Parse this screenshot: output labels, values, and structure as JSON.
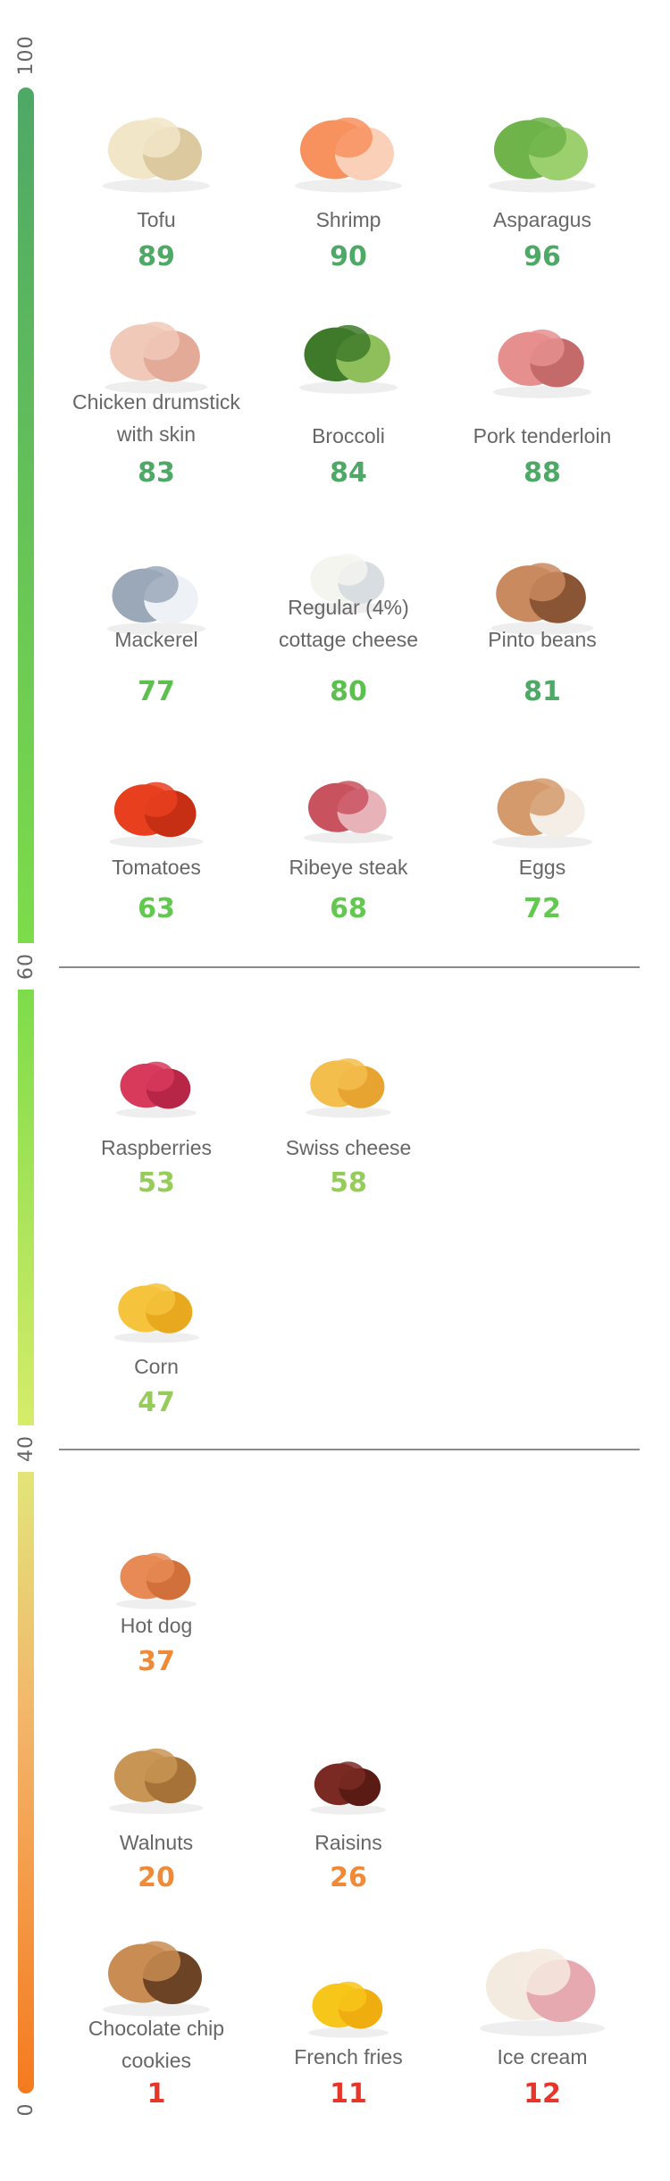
{
  "chart_data": {
    "type": "table",
    "title": "",
    "scale": {
      "min": 0,
      "max": 100,
      "ticks": [
        100,
        60,
        40,
        0
      ]
    },
    "bands": [
      {
        "from": 60,
        "to": 100,
        "colors": [
          "#4ea866",
          "#7ddc4a"
        ]
      },
      {
        "from": 40,
        "to": 60,
        "colors": [
          "#7ddc4a",
          "#d6ec6a"
        ]
      },
      {
        "from": 0,
        "to": 40,
        "colors": [
          "#e2e57a",
          "#f57a1e"
        ]
      }
    ],
    "items": [
      {
        "name": "Tofu",
        "value": 89,
        "band": 0
      },
      {
        "name": "Shrimp",
        "value": 90,
        "band": 0
      },
      {
        "name": "Asparagus",
        "value": 96,
        "band": 0
      },
      {
        "name": "Chicken drumstick with skin",
        "value": 83,
        "band": 0
      },
      {
        "name": "Broccoli",
        "value": 84,
        "band": 0
      },
      {
        "name": "Pork tenderloin",
        "value": 88,
        "band": 0
      },
      {
        "name": "Mackerel",
        "value": 77,
        "band": 0
      },
      {
        "name": "Regular (4%) cottage cheese",
        "value": 80,
        "band": 0
      },
      {
        "name": "Pinto beans",
        "value": 81,
        "band": 0
      },
      {
        "name": "Tomatoes",
        "value": 63,
        "band": 0
      },
      {
        "name": "Ribeye steak",
        "value": 68,
        "band": 0
      },
      {
        "name": "Eggs",
        "value": 72,
        "band": 0
      },
      {
        "name": "Raspberries",
        "value": 53,
        "band": 1
      },
      {
        "name": "Swiss cheese",
        "value": 58,
        "band": 1
      },
      {
        "name": "Corn",
        "value": 47,
        "band": 1
      },
      {
        "name": "Hot dog",
        "value": 37,
        "band": 2
      },
      {
        "name": "Walnuts",
        "value": 20,
        "band": 2
      },
      {
        "name": "Raisins",
        "value": 26,
        "band": 2
      },
      {
        "name": "Chocolate chip cookies",
        "value": 1,
        "band": 2
      },
      {
        "name": "French fries",
        "value": 11,
        "band": 2
      },
      {
        "name": "Ice cream",
        "value": 12,
        "band": 2
      }
    ]
  },
  "axis_labels": [
    "100",
    "60",
    "40",
    "0"
  ],
  "items": [
    {
      "line1": "Tofu",
      "line2": "",
      "value": "89",
      "color": "#4ea866",
      "icon": "tofu-image"
    },
    {
      "line1": "Shrimp",
      "line2": "",
      "value": "90",
      "color": "#4ea866",
      "icon": "shrimp-image"
    },
    {
      "line1": "Asparagus",
      "line2": "",
      "value": "96",
      "color": "#4ea866",
      "icon": "asparagus-image"
    },
    {
      "line1": "Chicken drumstick",
      "line2": "with skin",
      "value": "83",
      "color": "#4ea866",
      "icon": "chicken-drumstick-image"
    },
    {
      "line1": "Broccoli",
      "line2": "",
      "value": "84",
      "color": "#4ea866",
      "icon": "broccoli-image"
    },
    {
      "line1": "Pork tenderloin",
      "line2": "",
      "value": "88",
      "color": "#4ea866",
      "icon": "pork-tenderloin-image"
    },
    {
      "line1": "Mackerel",
      "line2": "",
      "value": "77",
      "color": "#5cc04f",
      "icon": "mackerel-image"
    },
    {
      "line1": "Regular (4%)",
      "line2": "cottage cheese",
      "value": "80",
      "color": "#5cc04f",
      "icon": "cottage-cheese-image"
    },
    {
      "line1": "Pinto beans",
      "line2": "",
      "value": "81",
      "color": "#4ea866",
      "icon": "pinto-beans-image"
    },
    {
      "line1": "Tomatoes",
      "line2": "",
      "value": "63",
      "color": "#62c94f",
      "icon": "tomatoes-image"
    },
    {
      "line1": "Ribeye steak",
      "line2": "",
      "value": "68",
      "color": "#62c94f",
      "icon": "ribeye-steak-image"
    },
    {
      "line1": "Eggs",
      "line2": "",
      "value": "72",
      "color": "#62c94f",
      "icon": "eggs-image"
    },
    {
      "line1": "Raspberries",
      "line2": "",
      "value": "53",
      "color": "#96cc5a",
      "icon": "raspberries-image"
    },
    {
      "line1": "Swiss cheese",
      "line2": "",
      "value": "58",
      "color": "#96cc5a",
      "icon": "swiss-cheese-image"
    },
    {
      "line1": "Corn",
      "line2": "",
      "value": "47",
      "color": "#96cc5a",
      "icon": "corn-image"
    },
    {
      "line1": "Hot dog",
      "line2": "",
      "value": "37",
      "color": "#f08a36",
      "icon": "hot-dog-image"
    },
    {
      "line1": "Walnuts",
      "line2": "",
      "value": "20",
      "color": "#f08a36",
      "icon": "walnuts-image"
    },
    {
      "line1": "Raisins",
      "line2": "",
      "value": "26",
      "color": "#f08a36",
      "icon": "raisins-image"
    },
    {
      "line1": "Chocolate chip",
      "line2": "cookies",
      "value": "1",
      "color": "#e8352a",
      "icon": "cookies-image"
    },
    {
      "line1": "French fries",
      "line2": "",
      "value": "11",
      "color": "#e8352a",
      "icon": "french-fries-image"
    },
    {
      "line1": "Ice cream",
      "line2": "",
      "value": "12",
      "color": "#e8352a",
      "icon": "ice-cream-image"
    }
  ]
}
